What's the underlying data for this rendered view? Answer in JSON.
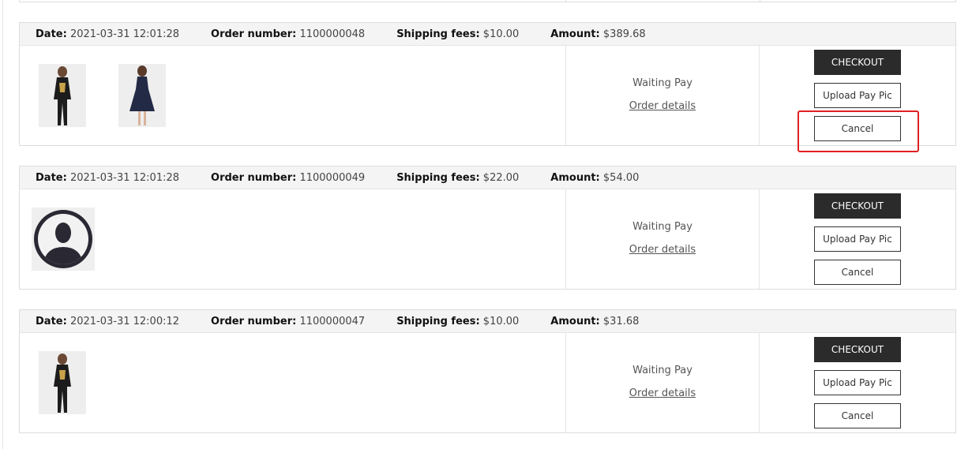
{
  "labels": {
    "date": "Date:",
    "order_number": "Order number:",
    "shipping_fees": "Shipping fees:",
    "amount": "Amount:"
  },
  "orders": [
    {
      "date": "2021-03-31 12:01:28",
      "order_number": "1100000048",
      "shipping_fees": "$10.00",
      "amount": "$389.68",
      "status": "Waiting Pay",
      "details_link": "Order details",
      "buttons": {
        "checkout": "CHECKOUT",
        "upload": "Upload Pay Pic",
        "cancel": "Cancel"
      },
      "products": [
        "black-outfit-product-image",
        "navy-dress-product-image"
      ]
    },
    {
      "date": "2021-03-31 12:01:28",
      "order_number": "1100000049",
      "shipping_fees": "$22.00",
      "amount": "$54.00",
      "status": "Waiting Pay",
      "details_link": "Order details",
      "buttons": {
        "checkout": "CHECKOUT",
        "upload": "Upload Pay Pic",
        "cancel": "Cancel"
      },
      "products": [
        "user-avatar-placeholder-icon"
      ]
    },
    {
      "date": "2021-03-31 12:00:12",
      "order_number": "1100000047",
      "shipping_fees": "$10.00",
      "amount": "$31.68",
      "status": "Waiting Pay",
      "details_link": "Order details",
      "buttons": {
        "checkout": "CHECKOUT",
        "upload": "Upload Pay Pic",
        "cancel": "Cancel"
      },
      "products": [
        "black-outfit-product-image"
      ]
    }
  ],
  "colors": {
    "header_bg": "#f4f4f4",
    "checkout_bg": "#2b2b2b",
    "highlight": "#e02020"
  }
}
